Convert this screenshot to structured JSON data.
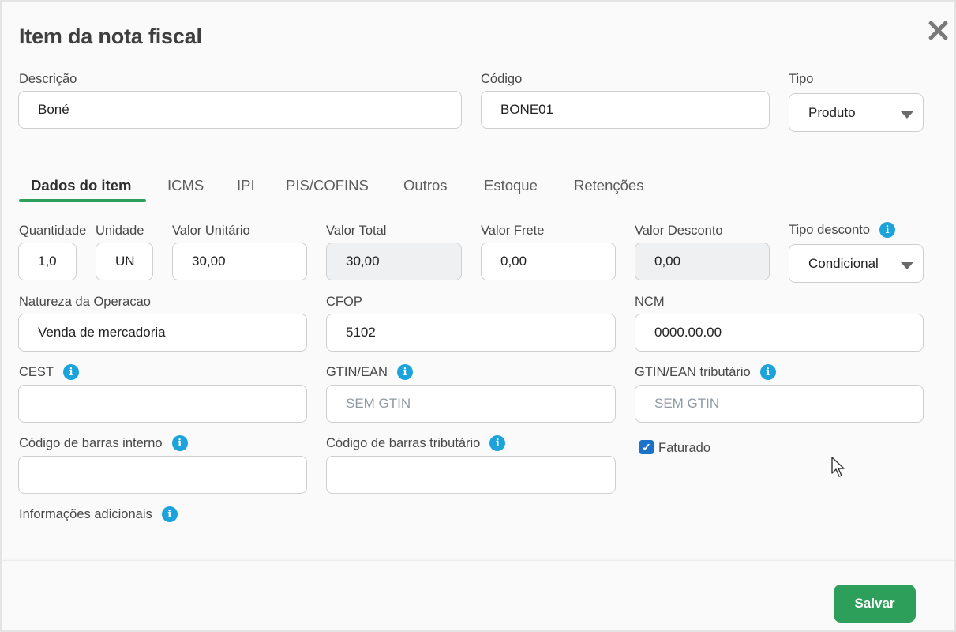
{
  "modal": {
    "title": "Item da nota fiscal"
  },
  "header": {
    "descricao": {
      "label": "Descrição",
      "value": "Boné"
    },
    "codigo": {
      "label": "Código",
      "value": "BONE01"
    },
    "tipo": {
      "label": "Tipo",
      "value": "Produto"
    }
  },
  "tabs": [
    {
      "label": "Dados do item",
      "active": true
    },
    {
      "label": "ICMS"
    },
    {
      "label": "IPI"
    },
    {
      "label": "PIS/COFINS"
    },
    {
      "label": "Outros"
    },
    {
      "label": "Estoque"
    },
    {
      "label": "Retenções"
    }
  ],
  "fields": {
    "quantidade": {
      "label": "Quantidade",
      "value": "1,0"
    },
    "unidade": {
      "label": "Unidade",
      "value": "UN"
    },
    "valor_unitario": {
      "label": "Valor Unitário",
      "value": "30,00"
    },
    "valor_total": {
      "label": "Valor Total",
      "value": "30,00"
    },
    "valor_frete": {
      "label": "Valor Frete",
      "value": "0,00"
    },
    "valor_desconto": {
      "label": "Valor Desconto",
      "value": "0,00"
    },
    "tipo_desconto": {
      "label": "Tipo desconto",
      "value": "Condicional"
    },
    "natureza": {
      "label": "Natureza da Operacao",
      "value": "Venda de mercadoria"
    },
    "cfop": {
      "label": "CFOP",
      "value": "5102"
    },
    "ncm": {
      "label": "NCM",
      "value": "0000.00.00"
    },
    "cest": {
      "label": "CEST",
      "value": ""
    },
    "gtin": {
      "label": "GTIN/EAN",
      "placeholder": "SEM GTIN"
    },
    "gtin_trib": {
      "label": "GTIN/EAN tributário",
      "placeholder": "SEM GTIN"
    },
    "barras_interno": {
      "label": "Código de barras interno",
      "value": ""
    },
    "barras_trib": {
      "label": "Código de barras tributário",
      "value": ""
    },
    "faturado": {
      "label": "Faturado",
      "checked": true
    },
    "info_adicionais": {
      "label": "Informações adicionais"
    }
  },
  "footer": {
    "save_label": "Salvar"
  },
  "icons": {
    "info_glyph": "i",
    "check_glyph": "✓"
  },
  "colors": {
    "accent_green": "#2e9f5b",
    "info_blue": "#1ca3dc",
    "checkbox_blue": "#1a73c9"
  }
}
